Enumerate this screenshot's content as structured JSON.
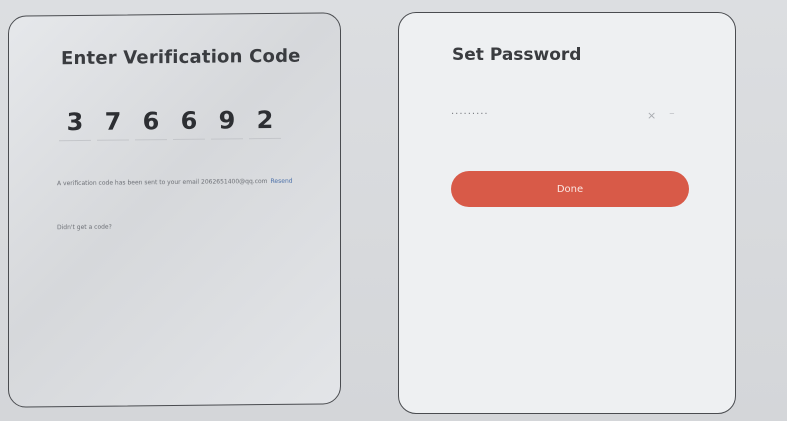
{
  "verification": {
    "title": "Enter Verification Code",
    "digits": [
      "3",
      "7",
      "6",
      "6",
      "9",
      "2"
    ],
    "info_text": "A verification code has been sent to your email 2062651400@qq.com",
    "resend_label": "Resend",
    "didnt_get_label": "Didn't get a code?"
  },
  "set_password": {
    "title": "Set Password",
    "password_value": "·········",
    "clear_icon": "×",
    "eye_icon": "⁻",
    "done_label": "Done",
    "accent_color": "#d85a48"
  }
}
